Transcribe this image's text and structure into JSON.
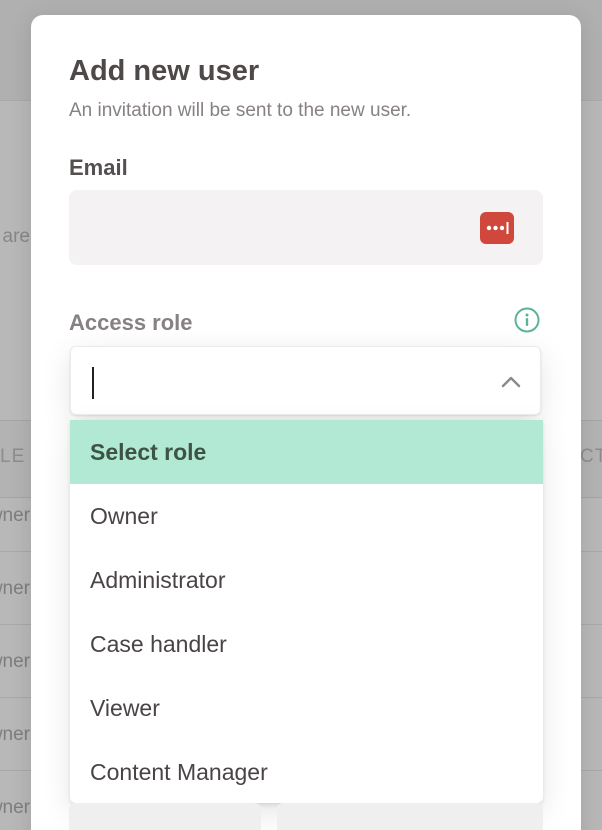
{
  "modal": {
    "title": "Add new user",
    "subtitle": "An invitation will be sent to the new user."
  },
  "email": {
    "label": "Email",
    "value": "",
    "placeholder": ""
  },
  "access_role": {
    "label": "Access role",
    "search_value": "",
    "options": [
      {
        "label": "Select role",
        "selected": true
      },
      {
        "label": "Owner",
        "selected": false
      },
      {
        "label": "Administrator",
        "selected": false
      },
      {
        "label": "Case handler",
        "selected": false
      },
      {
        "label": "Viewer",
        "selected": false
      },
      {
        "label": "Content Manager",
        "selected": false
      }
    ]
  },
  "background": {
    "partial_text": "s are",
    "table_header_left": "LE",
    "table_header_right": "CT",
    "row_cell_text": "wner"
  },
  "icons": {
    "password_manager": "password-manager-icon",
    "info": "info-icon",
    "chevron": "chevron-up-icon"
  },
  "colors": {
    "accent_green": "#5db39a",
    "selected_bg": "#b2e9d4",
    "password_icon_red": "#d0473b"
  }
}
